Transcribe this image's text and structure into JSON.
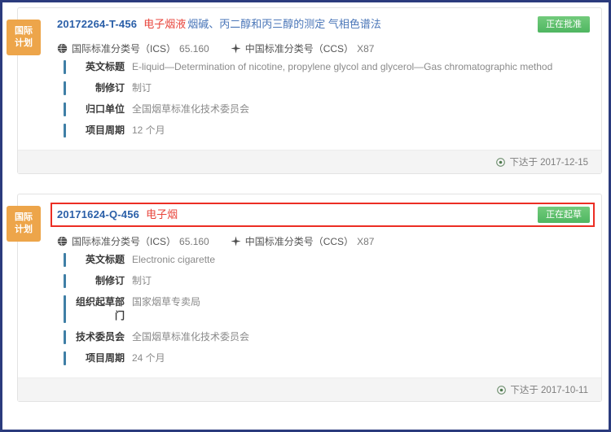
{
  "theme": {
    "frame_border": "#2b3b7d",
    "plan_badge_bg": "#eda54a",
    "status_badge_bg": "#5ec16b",
    "highlight_border": "#ec2e24",
    "std_no_color": "#2a5fa8",
    "std_name_color": "#e8453c",
    "detail_bar_color": "#3f7fa6",
    "footer_bg": "#f4f4f4"
  },
  "cards": [
    {
      "plan_badge": {
        "line1": "国际",
        "line2": "计划"
      },
      "highlighted": false,
      "std_no": "20172264-T-456",
      "std_name": "电子烟液",
      "std_name_rest": "烟碱、丙二醇和丙三醇的测定 气相色谱法",
      "status": "正在批准",
      "classifications": [
        {
          "icon": "globe-icon",
          "label": "国际标准分类号（ICS）",
          "value": "65.160"
        },
        {
          "icon": "compass-icon",
          "label": "中国标准分类号（CCS）",
          "value": "X87"
        }
      ],
      "details": [
        {
          "label": "英文标题",
          "value": "E-liquid—Determination of nicotine, propylene glycol and glycerol—Gas chromatographic method"
        },
        {
          "label": "制修订",
          "value": "制订"
        },
        {
          "label": "归口单位",
          "value": "全国烟草标准化技术委员会"
        },
        {
          "label": "项目周期",
          "value": "12 个月"
        }
      ],
      "footer": {
        "icon": "clock-icon",
        "text": "下达于 2017-12-15"
      }
    },
    {
      "plan_badge": {
        "line1": "国际",
        "line2": "计划"
      },
      "highlighted": true,
      "std_no": "20171624-Q-456",
      "std_name": "电子烟",
      "std_name_rest": "",
      "status": "正在起草",
      "classifications": [
        {
          "icon": "globe-icon",
          "label": "国际标准分类号（ICS）",
          "value": "65.160"
        },
        {
          "icon": "compass-icon",
          "label": "中国标准分类号（CCS）",
          "value": "X87"
        }
      ],
      "details": [
        {
          "label": "英文标题",
          "value": "Electronic cigarette"
        },
        {
          "label": "制修订",
          "value": "制订"
        },
        {
          "label": "组织起草部门",
          "value": "国家烟草专卖局"
        },
        {
          "label": "技术委员会",
          "value": "全国烟草标准化技术委员会"
        },
        {
          "label": "项目周期",
          "value": "24 个月"
        }
      ],
      "footer": {
        "icon": "clock-icon",
        "text": "下达于 2017-10-11"
      }
    }
  ]
}
